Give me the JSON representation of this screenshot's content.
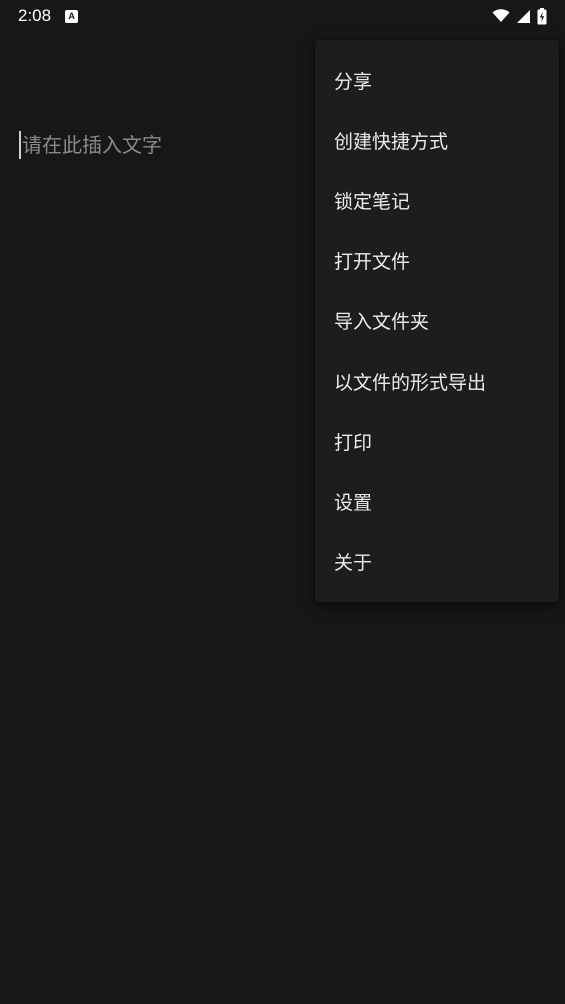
{
  "status_bar": {
    "time": "2:08",
    "notification_icon": "a-icon",
    "icons": [
      "wifi-icon",
      "signal-icon",
      "battery-charging-icon"
    ]
  },
  "editor": {
    "placeholder": "请在此插入文字",
    "value": ""
  },
  "menu": {
    "items": [
      {
        "label": "分享"
      },
      {
        "label": "创建快捷方式"
      },
      {
        "label": "锁定笔记"
      },
      {
        "label": "打开文件"
      },
      {
        "label": "导入文件夹"
      },
      {
        "label": "以文件的形式导出"
      },
      {
        "label": "打印"
      },
      {
        "label": "设置"
      },
      {
        "label": "关于"
      }
    ]
  },
  "colors": {
    "background": "#171717",
    "menu_background": "#1d1d1d",
    "text": "#ececec",
    "placeholder": "#8a8a8a"
  }
}
